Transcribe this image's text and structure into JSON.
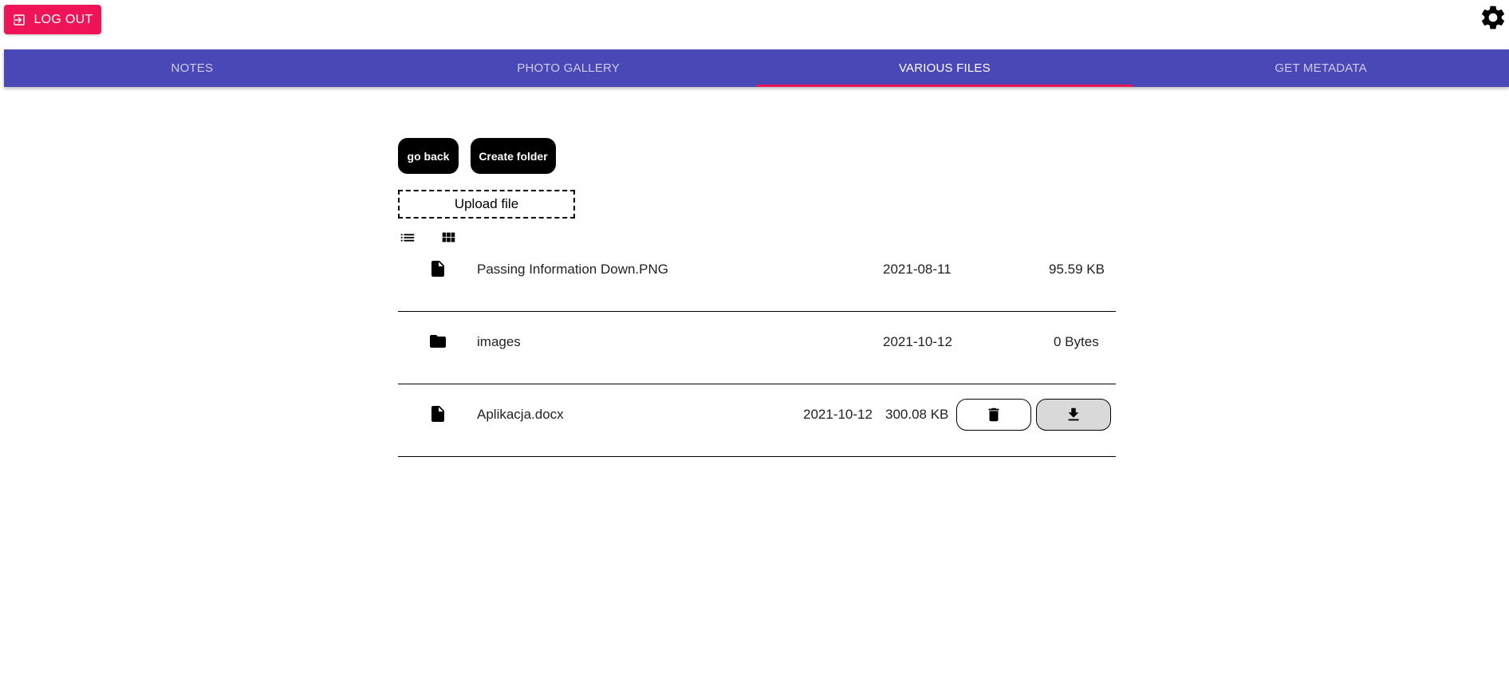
{
  "header": {
    "logout_label": "LOG OUT",
    "logout_icon": "logout-icon",
    "settings_icon": "gear-icon"
  },
  "tabs": [
    {
      "label": "NOTES",
      "active": false
    },
    {
      "label": "PHOTO GALLERY",
      "active": false
    },
    {
      "label": "VARIOUS FILES",
      "active": true
    },
    {
      "label": "GET METADATA",
      "active": false
    }
  ],
  "toolbar": {
    "go_back_label": "go back",
    "create_folder_label": "Create folder",
    "upload_label": "Upload file",
    "view_modes": [
      "list-view-icon",
      "grid-view-icon"
    ]
  },
  "files": [
    {
      "type": "file",
      "icon": "file-icon",
      "name": "Passing Information Down.PNG",
      "date": "2021-08-11",
      "size": "95.59 KB"
    },
    {
      "type": "folder",
      "icon": "folder-icon",
      "name": "images",
      "date": "2021-10-12",
      "size": "0 Bytes"
    },
    {
      "type": "file",
      "icon": "file-icon",
      "name": "Aplikacja.docx",
      "date": "2021-10-12",
      "size": "300.08 KB",
      "actions": [
        "delete-icon",
        "download-icon"
      ]
    }
  ],
  "colors": {
    "accent": "#ef1458",
    "tabbar": "#4a47b7",
    "download_button_bg": "#d9d9d9"
  }
}
